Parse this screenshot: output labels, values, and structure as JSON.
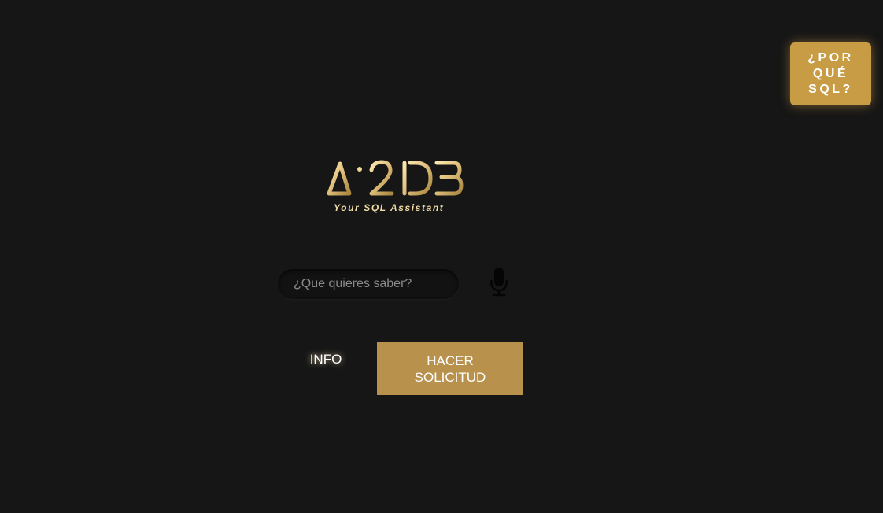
{
  "header": {
    "why_sql_label": "¿POR QUÉ SQL?"
  },
  "logo": {
    "brand": "Ai2DB",
    "tagline": "Your SQL Assistant"
  },
  "search": {
    "placeholder": "¿Que quieres saber?",
    "value": ""
  },
  "mic": {
    "icon": "microphone-icon"
  },
  "actions": {
    "info_label": "INFO",
    "submit_label": "HACER SOLICITUD"
  },
  "colors": {
    "background": "#161616",
    "accent_gold": "#c89b45",
    "button_gold": "#b8914d"
  }
}
